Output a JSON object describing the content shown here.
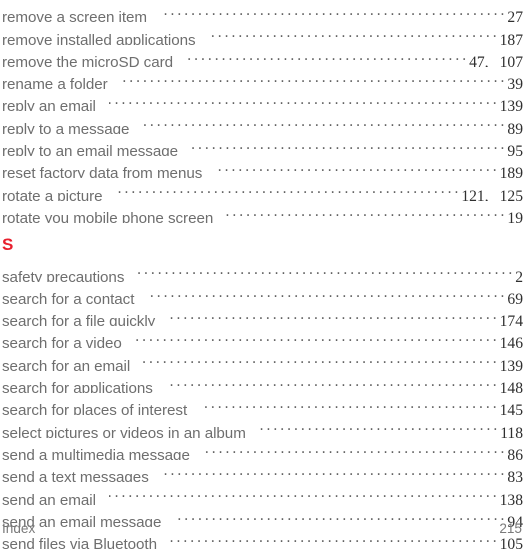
{
  "document": {
    "type": "index-page",
    "footer": {
      "label": "Index",
      "page_number": "215"
    },
    "colors": {
      "section_heading": "#e8202e",
      "entry_text": "#6e6e6e",
      "page_number": "#2f2f2f",
      "footer_text": "#7a7a7a",
      "background": "#ffffff"
    }
  },
  "blocks": [
    {
      "kind": "entries",
      "items": [
        {
          "label": "remove a screen item",
          "pages": [
            "27"
          ]
        },
        {
          "label": "remove installed applications",
          "pages": [
            "187"
          ]
        },
        {
          "label": "remove the microSD card",
          "pages": [
            "47,",
            "107"
          ]
        },
        {
          "label": "rename a folder",
          "pages": [
            "39"
          ]
        },
        {
          "label": "reply an email",
          "pages": [
            "139"
          ]
        },
        {
          "label": "reply to a message",
          "pages": [
            "89"
          ]
        },
        {
          "label": "reply to an email message",
          "pages": [
            "95"
          ]
        },
        {
          "label": "reset factory data from menus",
          "pages": [
            "189"
          ]
        },
        {
          "label": "rotate a picture",
          "pages": [
            "121,",
            "125"
          ]
        },
        {
          "label": "rotate you mobile phone screen",
          "pages": [
            "19"
          ]
        }
      ]
    },
    {
      "kind": "section",
      "heading": "S",
      "items": [
        {
          "label": "safety precautions",
          "pages": [
            "2"
          ]
        },
        {
          "label": "search for a contact",
          "pages": [
            "69"
          ]
        },
        {
          "label": "search for a file quickly",
          "pages": [
            "174"
          ]
        },
        {
          "label": "search for a video",
          "pages": [
            "146"
          ]
        },
        {
          "label": "search for an email",
          "pages": [
            "139"
          ]
        },
        {
          "label": "search for applications",
          "pages": [
            "148"
          ]
        },
        {
          "label": "search for places of interest",
          "pages": [
            "145"
          ]
        },
        {
          "label": "select pictures or videos in an album",
          "pages": [
            "118"
          ]
        },
        {
          "label": "send a multimedia message",
          "pages": [
            "86"
          ]
        },
        {
          "label": "send a text messages",
          "pages": [
            "83"
          ]
        },
        {
          "label": "send an email",
          "pages": [
            "138"
          ]
        },
        {
          "label": "send an email message",
          "pages": [
            "94"
          ]
        },
        {
          "label": "send files via Bluetooth",
          "pages": [
            "105"
          ]
        }
      ]
    }
  ]
}
